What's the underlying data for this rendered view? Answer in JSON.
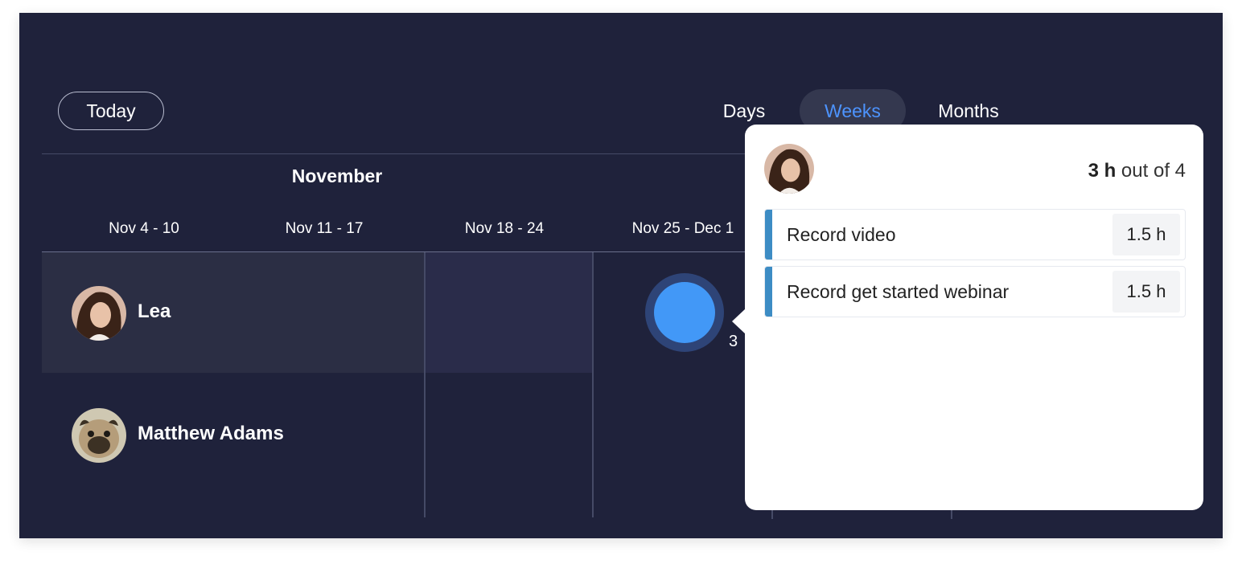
{
  "toolbar": {
    "today_label": "Today",
    "view_tabs": [
      "Days",
      "Weeks",
      "Months"
    ],
    "active_view": "Weeks"
  },
  "timeline": {
    "month": "November",
    "weeks": [
      "Nov 4 - 10",
      "Nov 11 - 17",
      "Nov 18 - 24",
      "Nov 25 - Dec 1"
    ]
  },
  "people": [
    {
      "name": "Lea",
      "avatar": "woman-photo"
    },
    {
      "name": "Matthew Adams",
      "avatar": "pug-photo"
    }
  ],
  "workload_bubble": {
    "count": "3",
    "color": "#4298f7"
  },
  "popup": {
    "hours_used": "3 h",
    "hours_total_text": " out of 4",
    "tasks": [
      {
        "name": "Record video",
        "hours": "1.5 h"
      },
      {
        "name": "Record get started webinar",
        "hours": "1.5 h"
      }
    ],
    "accent": "#3d8cc4"
  },
  "colors": {
    "background": "#1f223b",
    "active_tab_text": "#4d94ff"
  }
}
